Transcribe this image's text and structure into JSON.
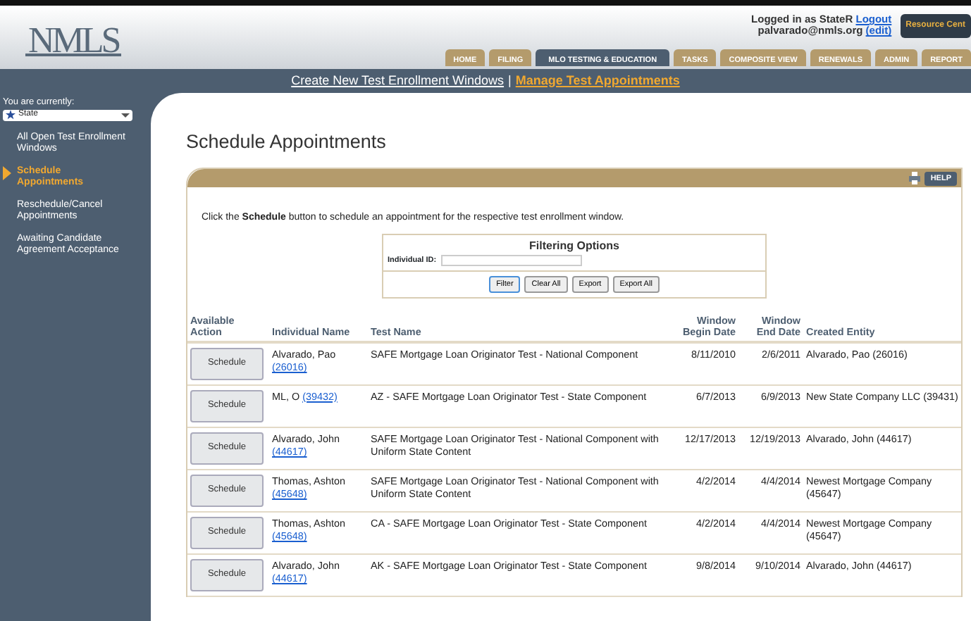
{
  "header": {
    "logo": "NMLS",
    "login_text": "Logged in as StateR",
    "logout": "Logout",
    "email": "palvarado@nmls.org",
    "edit": "(edit)",
    "resource_button": "Resource Cent"
  },
  "tabs": [
    {
      "label": "HOME",
      "selected": false
    },
    {
      "label": "FILING",
      "selected": false
    },
    {
      "label": "MLO TESTING & EDUCATION",
      "selected": true
    },
    {
      "label": "TASKS",
      "selected": false
    },
    {
      "label": "COMPOSITE VIEW",
      "selected": false
    },
    {
      "label": "RENEWALS",
      "selected": false
    },
    {
      "label": "ADMIN",
      "selected": false
    },
    {
      "label": "REPORT",
      "selected": false
    }
  ],
  "subnav_separator": "|",
  "subnav": [
    {
      "label": "Create New Test Enrollment Windows",
      "selected": false
    },
    {
      "label": "Manage Test Appointments",
      "selected": true
    }
  ],
  "sidebar": {
    "caption": "You are currently:",
    "role": "State",
    "items": [
      {
        "label": "All Open Test Enrollment Windows",
        "selected": false
      },
      {
        "label": "Schedule Appointments",
        "selected": true
      },
      {
        "label": "Reschedule/Cancel Appointments",
        "selected": false
      },
      {
        "label": "Awaiting Candidate Agreement Acceptance",
        "selected": false
      }
    ]
  },
  "page_title": "Schedule Appointments",
  "help_button": "HELP",
  "instruction": "Click the **Schedule** button to schedule an appointment for the respective test enrollment window.",
  "filter": {
    "title": "Filtering Options",
    "field_label": "Individual ID:",
    "buttons": [
      {
        "label": "Filter",
        "selected": true
      },
      {
        "label": "Clear All",
        "selected": false
      },
      {
        "label": "Export",
        "selected": false
      },
      {
        "label": "Export All",
        "selected": false
      }
    ]
  },
  "table": {
    "columns": [
      "Available Action",
      "Individual Name",
      "Test Name",
      "Window Begin Date",
      "Window End Date",
      "Created Entity"
    ],
    "rows": [
      {
        "action": "Schedule",
        "name": "Alvarado, Pao",
        "id": "(26016)",
        "test": "SAFE Mortgage Loan Originator Test - National Component",
        "begin": "8/11/2010",
        "end": "2/6/2011",
        "entity": "Alvarado, Pao (26016)"
      },
      {
        "action": "Schedule",
        "name": "ML, O",
        "id": "(39432)",
        "test": "AZ - SAFE Mortgage Loan Originator Test - State Component",
        "begin": "6/7/2013",
        "end": "6/9/2013",
        "entity": "New State Company LLC (39431)"
      },
      {
        "action": "Schedule",
        "name": "Alvarado, John",
        "id": "(44617)",
        "test": "SAFE Mortgage Loan Originator Test - National Component with Uniform State Content",
        "begin": "12/17/2013",
        "end": "12/19/2013",
        "entity": "Alvarado, John (44617)"
      },
      {
        "action": "Schedule",
        "name": "Thomas, Ashton",
        "id": "(45648)",
        "test": "SAFE Mortgage Loan Originator Test - National Component with Uniform State Content",
        "begin": "4/2/2014",
        "end": "4/4/2014",
        "entity": "Newest Mortgage Company (45647)"
      },
      {
        "action": "Schedule",
        "name": "Thomas, Ashton",
        "id": "(45648)",
        "test": "CA - SAFE Mortgage Loan Originator Test - State Component",
        "begin": "4/2/2014",
        "end": "4/4/2014",
        "entity": "Newest Mortgage Company (45647)"
      },
      {
        "action": "Schedule",
        "name": "Alvarado, John",
        "id": "(44617)",
        "test": "AK - SAFE Mortgage Loan Originator Test - State Component",
        "begin": "9/8/2014",
        "end": "9/10/2014",
        "entity": "Alvarado, John (44617)"
      }
    ]
  }
}
